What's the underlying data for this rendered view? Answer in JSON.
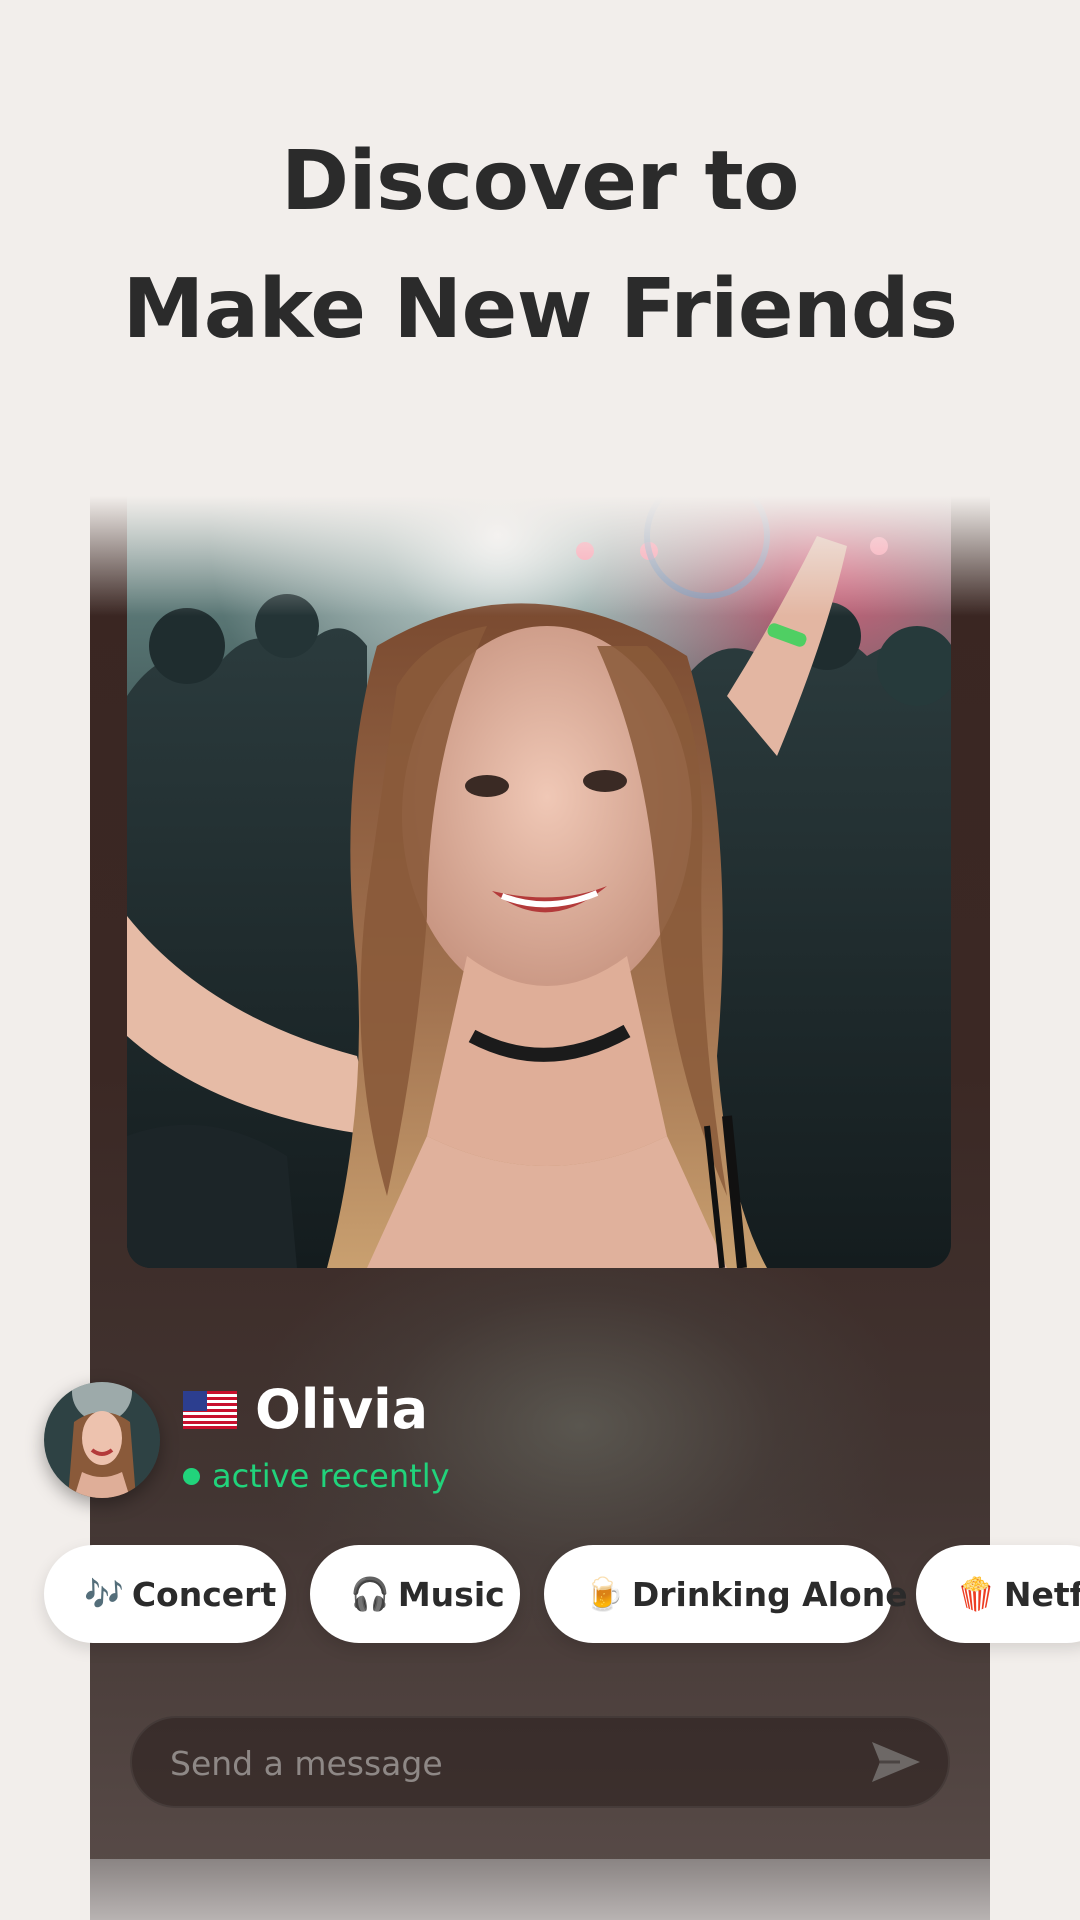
{
  "headline": {
    "line1": "Discover to",
    "line2": "Make New Friends"
  },
  "profile": {
    "flag_icon": "us-flag-icon",
    "name": "Olivia",
    "status": "active recently",
    "status_color": "#21d37b"
  },
  "interests": [
    {
      "icon": "🎶",
      "label": "Concert"
    },
    {
      "icon": "🎧",
      "label": "Music"
    },
    {
      "icon": "🍺",
      "label": "Drinking Alone"
    },
    {
      "icon": "🍿",
      "label": "Netflix"
    }
  ],
  "message": {
    "placeholder": "Send a message",
    "send_icon": "send-icon"
  },
  "colors": {
    "background": "#f2eeeb",
    "headline": "#2b2b2b",
    "card": "#3a2622",
    "chip": "#ffffff"
  }
}
